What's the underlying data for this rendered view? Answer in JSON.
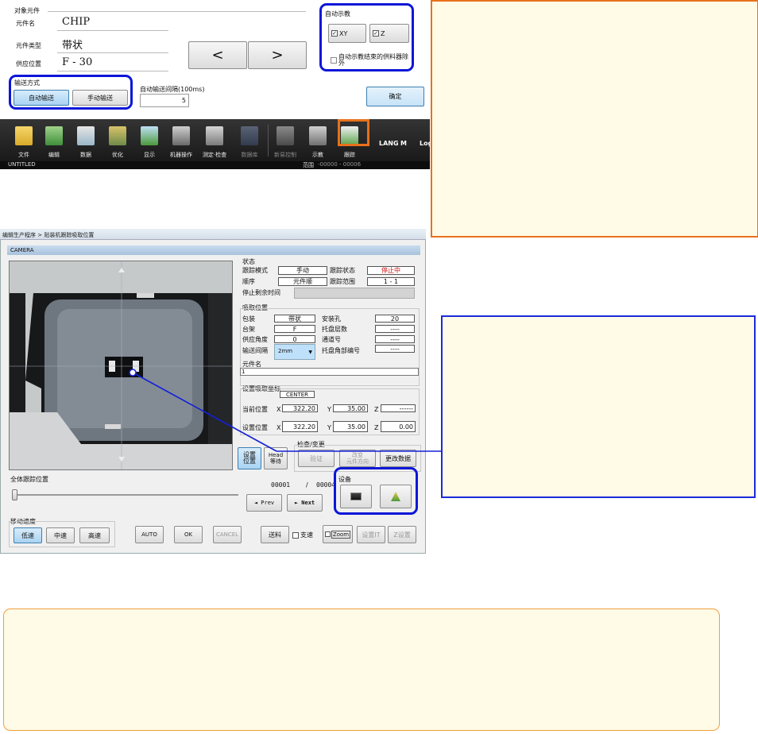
{
  "top_panel": {
    "target_group": "对象元件",
    "part_name_label": "元件名",
    "part_name_value": "CHIP",
    "part_type_label": "元件类型",
    "part_type_value": "带状",
    "feed_position_label": "供应位置",
    "feed_position_value": "F - 30",
    "prev_button": "<",
    "next_button": ">",
    "feed_mode_group": "输送方式",
    "auto_feed_button": "自动输送",
    "manual_feed_button": "手动输送",
    "auto_feed_interval_label": "自动输送间隔(100ms)",
    "auto_feed_interval_value": "5",
    "auto_teach_group": "自动示教",
    "xy_checkbox": "XY",
    "z_checkbox": "Z",
    "exclude_feeder_checkbox": "自动示教结束的供料器除外",
    "confirm_button": "确定"
  },
  "toolbar": {
    "items": [
      "文件",
      "编辑",
      "数据",
      "优化",
      "显示",
      "机器操作",
      "测定·检查",
      "数据库",
      "新易控制",
      "示教",
      "跟踪"
    ],
    "right_items": [
      "LANG",
      "M",
      "Log"
    ],
    "status_left": "UNTITLED",
    "status_range_label": "范围",
    "status_range_value": "-00000 - 00006"
  },
  "dialog": {
    "breadcrumb": "编辑生产程序 > 贴装机跟踪吸取位置",
    "camera_tab": "CAMERA",
    "status_group": "状态",
    "track_mode_label": "跟踪模式",
    "track_mode_value": "手动",
    "track_state_label": "跟踪状态",
    "track_state_value": "停止中",
    "order_label": "顺序",
    "order_value": "元件顺",
    "track_range_label": "跟踪范围",
    "track_range_value": "1 - 1",
    "stop_remaining_label": "停止剩余时间",
    "pick_group": "吸取位置",
    "package_label": "包装",
    "package_value": "带状",
    "mount_hole_label": "安装孔",
    "mount_hole_value": "20",
    "stand_label": "台架",
    "stand_value": "F",
    "tray_level_label": "托盘层数",
    "tray_level_value": "----",
    "feed_angle_label": "供应角度",
    "feed_angle_value": "0",
    "lane_label": "通道号",
    "lane_value": "----",
    "feed_pitch_label": "输送间隔",
    "feed_pitch_value": "2mm",
    "tray_corner_label": "托盘角部编号",
    "tray_corner_value": "----",
    "part_name_label": "元件名",
    "part_name_value": "1",
    "coord_group": "设置吸取坐标",
    "coord_mode_value": "CENTER",
    "current_pos_label": "当前位置",
    "set_pos_label": "设置位置",
    "x_label": "X",
    "y_label": "Y",
    "z_label": "Z",
    "current_x": "322.20",
    "current_y": "35.00",
    "current_z": "------",
    "set_x": "322.20",
    "set_y": "35.00",
    "set_z": "0.00",
    "set_pos_button": "设置\n位置",
    "head_wait_button": "Head\n等待",
    "check_group": "检查/变更",
    "verify_button": "验证",
    "rotate_button": "改变\n元件方向",
    "change_data_button": "更改数据",
    "all_track_label": "全体跟踪位置",
    "counter_current": "00001",
    "counter_sep": "/",
    "counter_total": "00004",
    "prev_button": "◄ Prev",
    "next_button": "► Next",
    "device_group": "设备",
    "speed_group": "移动速度",
    "low_speed_button": "低速",
    "mid_speed_button": "中速",
    "high_speed_button": "高速",
    "auto_button": "AUTO",
    "ok_button": "OK",
    "cancel_button": "CANCEL",
    "feed_button": "送料",
    "fast_checkbox": "支速",
    "zoom_checkbox": "Zoom",
    "set_it_button": "设置IT",
    "z_set_button": "Z设置"
  },
  "colors": {
    "highlight_blue": "#0b16d8",
    "highlight_orange": "#e8711c",
    "note_bg": "#fffbe6",
    "toolbar_bg": "#1e1e1e",
    "state_red": "#d01010"
  }
}
